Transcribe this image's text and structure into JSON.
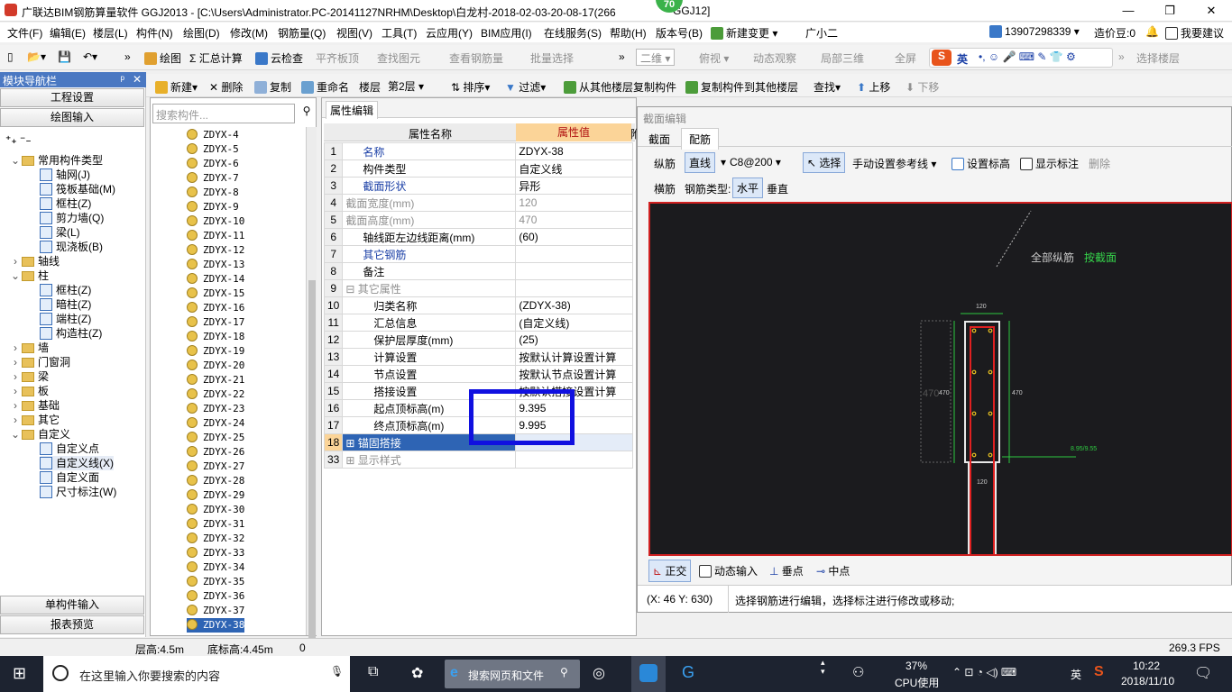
{
  "titlebar": {
    "title": "广联达BIM钢筋算量软件 GGJ2013 - [C:\\Users\\Administrator.PC-20141127NRHM\\Desktop\\白龙村-2018-02-03-20-08-17(266",
    "title_tail": "GGJ12]",
    "badge": "70",
    "min": "—",
    "max": "❐",
    "close": "✕"
  },
  "menu": [
    "文件(F)",
    "编辑(E)",
    "楼层(L)",
    "构件(N)",
    "绘图(D)",
    "修改(M)",
    "钢筋量(Q)",
    "视图(V)",
    "工具(T)",
    "云应用(Y)",
    "BIM应用(I)",
    "在线服务(S)",
    "帮助(H)",
    "版本号(B)",
    "新建变更",
    "广小二"
  ],
  "menu_right": {
    "phone": "13907298339",
    "price": "造价豆:0",
    "suggest": "我要建议"
  },
  "toolbar1": [
    "绘图",
    "Σ 汇总计算",
    "云检查",
    "平齐板顶",
    "查找图元",
    "查看钢筋量",
    "批量选择",
    "二维",
    "俯视",
    "动态观察",
    "局部三维",
    "全屏",
    "选择楼层"
  ],
  "ime": "英",
  "toolbar2": {
    "new": "新建",
    "delete": "删除",
    "copy": "复制",
    "rename": "重命名",
    "floor_label": "楼层",
    "floor_value": "第2层",
    "sort": "排序",
    "filter": "过滤",
    "copy_from": "从其他楼层复制构件",
    "copy_to": "复制构件到其他楼层",
    "find": "查找",
    "up": "上移",
    "down": "下移"
  },
  "nav": {
    "header": "模块导航栏",
    "pin": "ᵖ",
    "close": "✕",
    "btn_project": "工程设置",
    "btn_draw": "绘图输入",
    "btn_single": "单构件输入",
    "btn_report": "报表预览"
  },
  "tree": [
    {
      "label": "常用构件类型",
      "lvl": 0,
      "exp": "⌄",
      "type": "folder"
    },
    {
      "label": "轴网(J)",
      "lvl": 1,
      "type": "comp"
    },
    {
      "label": "筏板基础(M)",
      "lvl": 1,
      "type": "comp"
    },
    {
      "label": "框柱(Z)",
      "lvl": 1,
      "type": "comp"
    },
    {
      "label": "剪力墙(Q)",
      "lvl": 1,
      "type": "comp"
    },
    {
      "label": "梁(L)",
      "lvl": 1,
      "type": "comp"
    },
    {
      "label": "现浇板(B)",
      "lvl": 1,
      "type": "comp"
    },
    {
      "label": "轴线",
      "lvl": 0,
      "exp": "›",
      "type": "folder"
    },
    {
      "label": "柱",
      "lvl": 0,
      "exp": "⌄",
      "type": "folder"
    },
    {
      "label": "框柱(Z)",
      "lvl": 1,
      "type": "comp"
    },
    {
      "label": "暗柱(Z)",
      "lvl": 1,
      "type": "comp"
    },
    {
      "label": "端柱(Z)",
      "lvl": 1,
      "type": "comp"
    },
    {
      "label": "构造柱(Z)",
      "lvl": 1,
      "type": "comp"
    },
    {
      "label": "墙",
      "lvl": 0,
      "exp": "›",
      "type": "folder"
    },
    {
      "label": "门窗洞",
      "lvl": 0,
      "exp": "›",
      "type": "folder"
    },
    {
      "label": "梁",
      "lvl": 0,
      "exp": "›",
      "type": "folder"
    },
    {
      "label": "板",
      "lvl": 0,
      "exp": "›",
      "type": "folder"
    },
    {
      "label": "基础",
      "lvl": 0,
      "exp": "›",
      "type": "folder"
    },
    {
      "label": "其它",
      "lvl": 0,
      "exp": "›",
      "type": "folder"
    },
    {
      "label": "自定义",
      "lvl": 0,
      "exp": "⌄",
      "type": "folder"
    },
    {
      "label": "自定义点",
      "lvl": 1,
      "type": "comp"
    },
    {
      "label": "自定义线(X)",
      "lvl": 1,
      "type": "comp",
      "selected": true
    },
    {
      "label": "自定义面",
      "lvl": 1,
      "type": "comp"
    },
    {
      "label": "尺寸标注(W)",
      "lvl": 1,
      "type": "comp"
    }
  ],
  "list": {
    "search_placeholder": "搜索构件...",
    "items": [
      "ZDYX-4",
      "ZDYX-5",
      "ZDYX-6",
      "ZDYX-7",
      "ZDYX-8",
      "ZDYX-9",
      "ZDYX-10",
      "ZDYX-11",
      "ZDYX-12",
      "ZDYX-13",
      "ZDYX-14",
      "ZDYX-15",
      "ZDYX-16",
      "ZDYX-17",
      "ZDYX-18",
      "ZDYX-19",
      "ZDYX-20",
      "ZDYX-21",
      "ZDYX-22",
      "ZDYX-23",
      "ZDYX-24",
      "ZDYX-25",
      "ZDYX-26",
      "ZDYX-27",
      "ZDYX-28",
      "ZDYX-29",
      "ZDYX-30",
      "ZDYX-31",
      "ZDYX-32",
      "ZDYX-33",
      "ZDYX-34",
      "ZDYX-35",
      "ZDYX-36",
      "ZDYX-37",
      "ZDYX-38"
    ],
    "selected": "ZDYX-38"
  },
  "props": {
    "tab": "属性编辑",
    "col_name": "属性名称",
    "col_value": "属性值",
    "col_extra": "附",
    "rows": [
      {
        "n": "1",
        "k": "名称",
        "v": "ZDYX-38",
        "style": "blue"
      },
      {
        "n": "2",
        "k": "构件类型",
        "v": "自定义线",
        "style": ""
      },
      {
        "n": "3",
        "k": "截面形状",
        "v": "异形",
        "style": "blue"
      },
      {
        "n": "4",
        "k": "截面宽度(mm)",
        "v": "120",
        "style": "gray"
      },
      {
        "n": "5",
        "k": "截面高度(mm)",
        "v": "470",
        "style": "gray"
      },
      {
        "n": "6",
        "k": "轴线距左边线距离(mm)",
        "v": "(60)",
        "style": ""
      },
      {
        "n": "7",
        "k": "其它钢筋",
        "v": "",
        "style": "blue"
      },
      {
        "n": "8",
        "k": "备注",
        "v": "",
        "style": ""
      },
      {
        "n": "9",
        "k": "⊟ 其它属性",
        "v": "",
        "style": "gray"
      },
      {
        "n": "10",
        "k": "归类名称",
        "v": "(ZDYX-38)",
        "style": "sub"
      },
      {
        "n": "11",
        "k": "汇总信息",
        "v": "(自定义线)",
        "style": "sub"
      },
      {
        "n": "12",
        "k": "保护层厚度(mm)",
        "v": "(25)",
        "style": "sub"
      },
      {
        "n": "13",
        "k": "计算设置",
        "v": "按默认计算设置计算",
        "style": "sub"
      },
      {
        "n": "14",
        "k": "节点设置",
        "v": "按默认节点设置计算",
        "style": "sub"
      },
      {
        "n": "15",
        "k": "搭接设置",
        "v": "按默认搭接设置计算",
        "style": "sub"
      },
      {
        "n": "16",
        "k": "起点顶标高(m)",
        "v": "9.395",
        "style": "sub"
      },
      {
        "n": "17",
        "k": "终点顶标高(m)",
        "v": "9.995",
        "style": "sub"
      },
      {
        "n": "18",
        "k": "⊞ 锚固搭接",
        "v": "",
        "style": "selrow"
      },
      {
        "n": "33",
        "k": "⊞ 显示样式",
        "v": "",
        "style": "gray"
      }
    ]
  },
  "section": {
    "title": "截面编辑",
    "tab_section": "截面",
    "tab_rebar": "配筋",
    "lbl_long": "纵筋",
    "btn_straight": "直线",
    "rebar_spec": "C8@200",
    "btn_select": "选择",
    "btn_ref": "手动设置参考线",
    "btn_elev": "设置标高",
    "btn_show": "显示标注",
    "btn_del": "删除",
    "lbl_trans": "横筋",
    "lbl_type": "钢筋类型:",
    "btn_horizontal": "水平",
    "btn_vertical": "垂直",
    "canvas_note1": "全部纵筋",
    "canvas_note2": "按截面",
    "dim_top": "120",
    "dim_left": "470",
    "dim_right": "470",
    "dim_bottom": "120",
    "dim_big": "470",
    "dim_side": "8.95/9.55",
    "btn_ortho": "正交",
    "btn_dyn": "动态输入",
    "btn_perp": "垂点",
    "btn_mid": "中点",
    "coords": "(X: 46 Y: 630)",
    "hint": "选择钢筋进行编辑，选择标注进行修改或移动;"
  },
  "status": {
    "floor_h": "层高:4.5m",
    "bottom_h": "底标高:4.45m",
    "zero": "0",
    "fps": "269.3 FPS"
  },
  "taskbar": {
    "search": "在这里输入你要搜索的内容",
    "browser_search": "搜索网页和文件",
    "cpu_pct": "37%",
    "cpu_label": "CPU使用",
    "lang": "英",
    "time": "10:22",
    "date": "2018/11/10"
  },
  "colors": {
    "accent": "#2e64b4",
    "nav_header": "#4a78c2",
    "canvas_bg": "#1b1b1e",
    "rebar_red": "#e02020",
    "dim_green": "#2ec940",
    "highlight_blue": "#1010e0"
  }
}
